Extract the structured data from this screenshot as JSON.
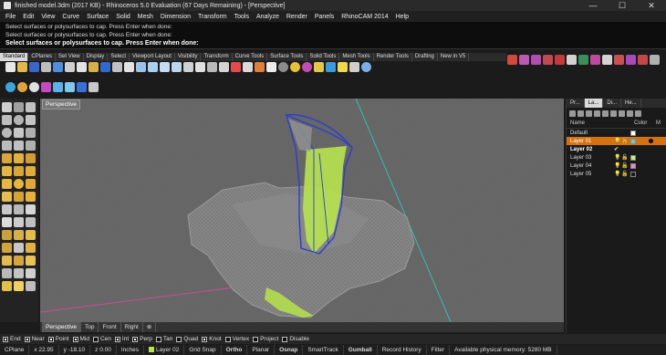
{
  "titlebar": {
    "title": "finished model.3dm (2017 KB) - Rhinoceros 5.0 Evaluation (67 Days Remaining) - [Perspective]",
    "minimize": "—",
    "maximize": "☐",
    "close": "✕"
  },
  "menu": [
    "File",
    "Edit",
    "View",
    "Curve",
    "Surface",
    "Solid",
    "Mesh",
    "Dimension",
    "Transform",
    "Tools",
    "Analyze",
    "Render",
    "Panels",
    "RhinoCAM 2014",
    "Help"
  ],
  "command": {
    "history": [
      "Select surfaces or polysurfaces to cap. Press Enter when done:",
      "Select surfaces or polysurfaces to cap. Press Enter when done:",
      "Select surfaces or polysurfaces to cap. Press Enter when done:"
    ],
    "prompt": "Select surfaces or polysurfaces to cap. Press Enter when done:"
  },
  "toolbar_tabs": [
    "Standard",
    "CPlanes",
    "Set View",
    "Display",
    "Select",
    "Viewport Layout",
    "Visibility",
    "Transform",
    "Curve Tools",
    "Surface Tools",
    "Solid Tools",
    "Mesh Tools",
    "Render Tools",
    "Drafting",
    "New in V5"
  ],
  "viewport": {
    "label": "Perspective",
    "tabs": [
      "Perspective",
      "Top",
      "Front",
      "Right"
    ],
    "add_tab": "⊕"
  },
  "osnaps": [
    {
      "label": "End",
      "checked": true
    },
    {
      "label": "Near",
      "checked": true
    },
    {
      "label": "Point",
      "checked": true
    },
    {
      "label": "Mid",
      "checked": true
    },
    {
      "label": "Cen",
      "checked": false
    },
    {
      "label": "Int",
      "checked": true
    },
    {
      "label": "Perp",
      "checked": true
    },
    {
      "label": "Tan",
      "checked": false
    },
    {
      "label": "Quad",
      "checked": false
    },
    {
      "label": "Knot",
      "checked": true
    },
    {
      "label": "Vertex",
      "checked": false
    },
    {
      "label": "Project",
      "checked": false
    },
    {
      "label": "Disable",
      "checked": false
    }
  ],
  "status": {
    "cplane": "CPlane",
    "x": "x 22.95",
    "y": "y -18.10",
    "z": "z 0.00",
    "units": "Inches",
    "layer": "Layer 02",
    "grid_snap": "Grid Snap",
    "ortho": "Ortho",
    "planar": "Planar",
    "osnap": "Osnap",
    "smarttrack": "SmartTrack",
    "gumball": "Gumball",
    "record_history": "Record History",
    "filter": "Filter",
    "memory": "Available physical memory: 5280 MB"
  },
  "panel": {
    "tabs": [
      "Pr...",
      "La...",
      "Di...",
      "He..."
    ],
    "col_name": "Name",
    "col_color": "Color",
    "col_mat": "M",
    "layers": [
      {
        "name": "Default",
        "color": "#ffffff",
        "state": "normal"
      },
      {
        "name": "Layer 01",
        "color": "#5ed0c8",
        "state": "selected"
      },
      {
        "name": "Layer 02",
        "color": "#b7e34c",
        "state": "current",
        "check": "✔"
      },
      {
        "name": "Layer 03",
        "color": "#c6f07a",
        "state": "normal"
      },
      {
        "name": "Layer 04",
        "color": "#e68ad6",
        "state": "normal"
      },
      {
        "name": "Layer 05",
        "color": "#1a1a1a",
        "state": "normal"
      }
    ]
  }
}
